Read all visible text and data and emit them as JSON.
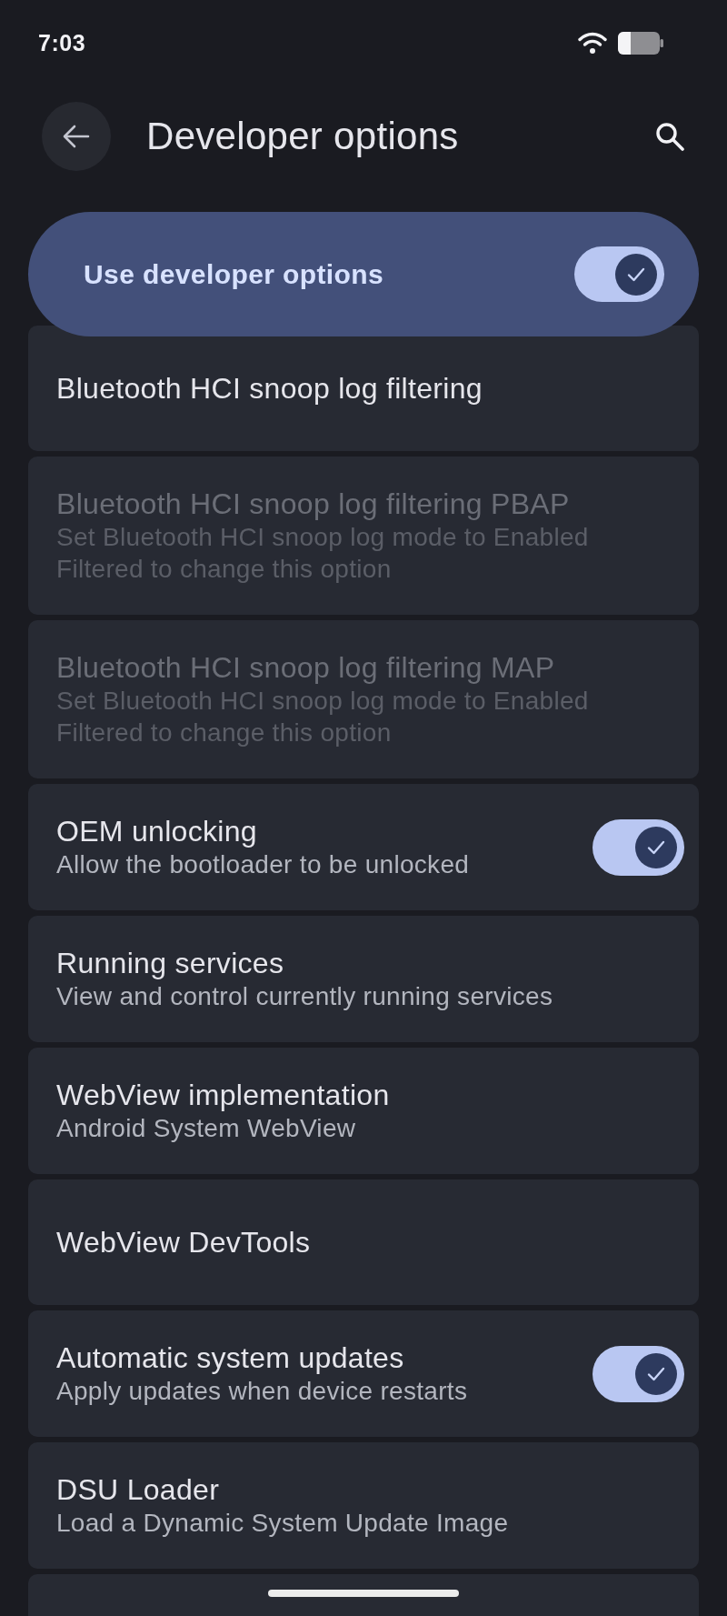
{
  "status_bar": {
    "time": "7:03"
  },
  "header": {
    "title": "Developer options"
  },
  "master_switch": {
    "label": "Use developer options",
    "on": true
  },
  "settings": [
    {
      "kind": "plain",
      "title": "Bluetooth HCI snoop log filtering",
      "disabled": false
    },
    {
      "kind": "plain",
      "title": "Bluetooth HCI snoop log filtering PBAP",
      "summary": "Set Bluetooth HCI snoop log mode to Enabled Filtered to change this option",
      "disabled": true
    },
    {
      "kind": "plain",
      "title": "Bluetooth HCI snoop log filtering MAP",
      "summary": "Set Bluetooth HCI snoop log mode to Enabled Filtered to change this option",
      "disabled": true
    },
    {
      "kind": "toggle",
      "title": "OEM unlocking",
      "summary": "Allow the bootloader to be unlocked",
      "disabled": false,
      "on": true
    },
    {
      "kind": "plain",
      "title": "Running services",
      "summary": "View and control currently running services",
      "disabled": false
    },
    {
      "kind": "plain",
      "title": "WebView implementation",
      "summary": "Android System WebView",
      "disabled": false
    },
    {
      "kind": "plain",
      "title": "WebView DevTools",
      "disabled": false
    },
    {
      "kind": "toggle",
      "title": "Automatic system updates",
      "summary": "Apply updates when device restarts",
      "disabled": false,
      "on": true
    },
    {
      "kind": "plain",
      "title": "DSU Loader",
      "summary": "Load a Dynamic System Update Image",
      "disabled": false
    },
    {
      "kind": "partial"
    }
  ]
}
